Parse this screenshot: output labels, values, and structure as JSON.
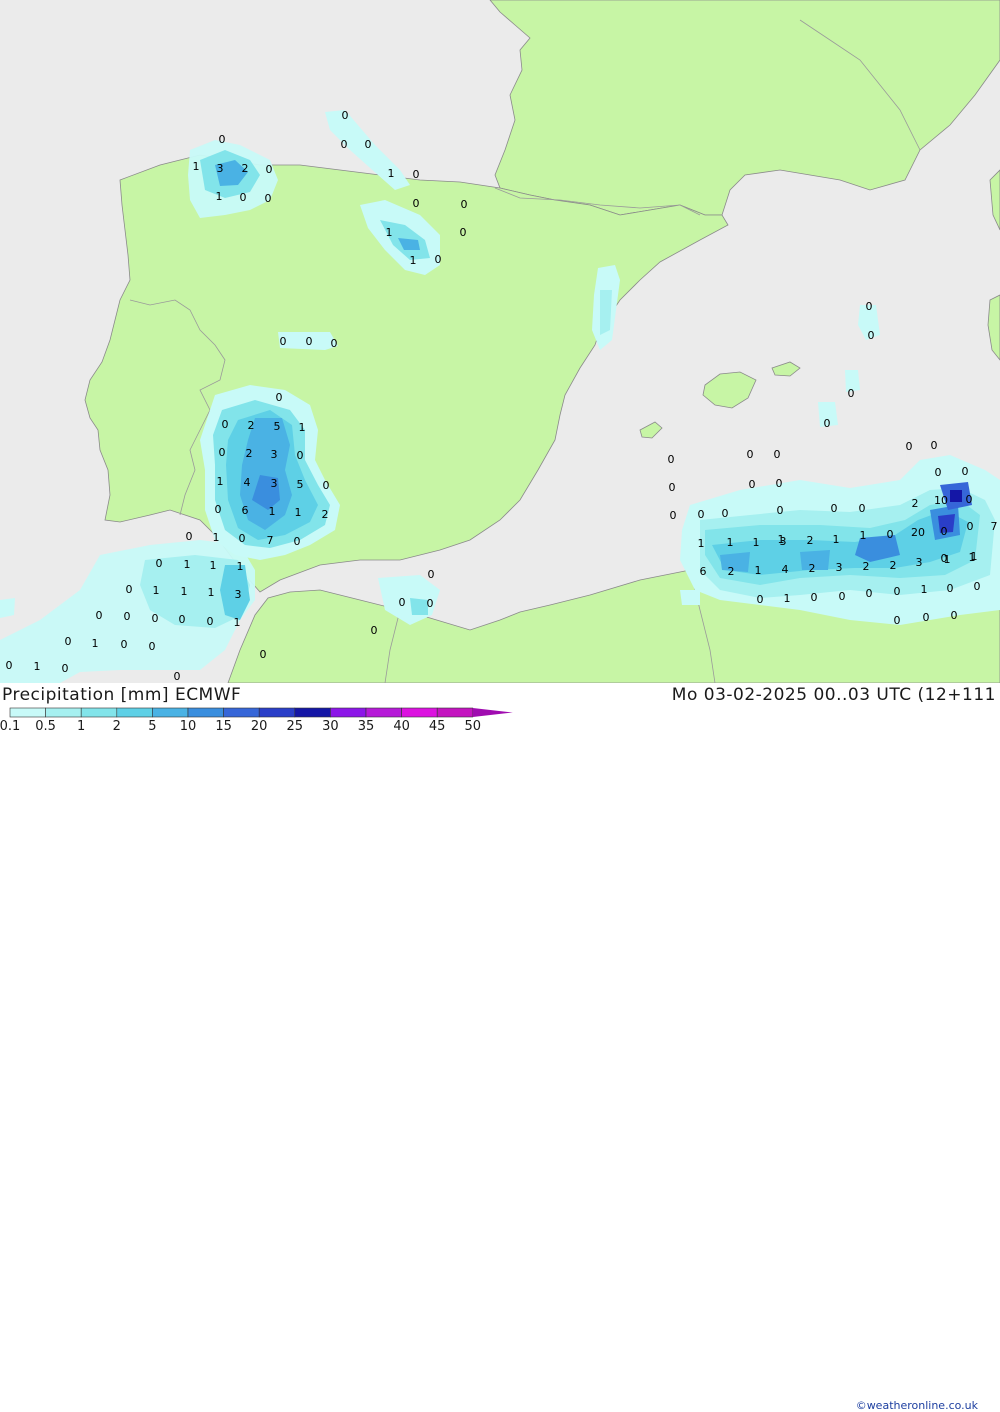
{
  "header": {
    "title": "Precipitation [mm] ECMWF",
    "datetime": "Mo 03-02-2025 00..03 UTC (12+111",
    "credit": "©weatheronline.co.uk"
  },
  "legend": {
    "labels": [
      "0.1",
      "0.5",
      "1",
      "2",
      "5",
      "10",
      "15",
      "20",
      "25",
      "30",
      "35",
      "40",
      "45",
      "50"
    ],
    "colors": [
      "#c8faf8",
      "#a6f0f0",
      "#82e4ea",
      "#5ed0e6",
      "#4ab2e4",
      "#3a8ede",
      "#3666d8",
      "#2a3ec8",
      "#1416a6",
      "#8c16e8",
      "#b61ad8",
      "#dc12e0",
      "#c414c0",
      "#a00cb0"
    ]
  },
  "colors": {
    "sea": "#ebebeb",
    "land": "#c7f5a5",
    "border": "#9a9a9a"
  },
  "map_values": [
    {
      "t": "0"
    },
    {
      "t": "1"
    },
    {
      "t": "3"
    },
    {
      "t": "2"
    },
    {
      "t": "0"
    },
    {
      "t": "1"
    },
    {
      "t": "0"
    },
    {
      "t": "0"
    },
    {
      "t": "0"
    },
    {
      "t": "0"
    },
    {
      "t": "0"
    },
    {
      "t": "1"
    },
    {
      "t": "0"
    },
    {
      "t": "0"
    },
    {
      "t": "0"
    },
    {
      "t": "0"
    },
    {
      "t": "1"
    },
    {
      "t": "1"
    },
    {
      "t": "0"
    },
    {
      "t": "0"
    },
    {
      "t": "0"
    },
    {
      "t": "0"
    },
    {
      "t": "0"
    },
    {
      "t": "0"
    },
    {
      "t": "2"
    },
    {
      "t": "5"
    },
    {
      "t": "1"
    },
    {
      "t": "0"
    },
    {
      "t": "2"
    },
    {
      "t": "3"
    },
    {
      "t": "0"
    },
    {
      "t": "1"
    },
    {
      "t": "4"
    },
    {
      "t": "3"
    },
    {
      "t": "5"
    },
    {
      "t": "0"
    },
    {
      "t": "0"
    },
    {
      "t": "6"
    },
    {
      "t": "1"
    },
    {
      "t": "1"
    },
    {
      "t": "2"
    },
    {
      "t": "0"
    },
    {
      "t": "1"
    },
    {
      "t": "0"
    },
    {
      "t": "7"
    },
    {
      "t": "0"
    },
    {
      "t": "0"
    },
    {
      "t": "1"
    },
    {
      "t": "1"
    },
    {
      "t": "1"
    },
    {
      "t": "0"
    },
    {
      "t": "1"
    },
    {
      "t": "1"
    },
    {
      "t": "1"
    },
    {
      "t": "3"
    },
    {
      "t": "0"
    },
    {
      "t": "0"
    },
    {
      "t": "0"
    },
    {
      "t": "0"
    },
    {
      "t": "0"
    },
    {
      "t": "1"
    },
    {
      "t": "0"
    },
    {
      "t": "1"
    },
    {
      "t": "0"
    },
    {
      "t": "0"
    },
    {
      "t": "0"
    },
    {
      "t": "1"
    },
    {
      "t": "0"
    },
    {
      "t": "0"
    },
    {
      "t": "0"
    },
    {
      "t": "0"
    },
    {
      "t": "0"
    },
    {
      "t": "0"
    },
    {
      "t": "0"
    },
    {
      "t": "0"
    },
    {
      "t": "0"
    },
    {
      "t": "0"
    },
    {
      "t": "0"
    },
    {
      "t": "0"
    },
    {
      "t": "0"
    },
    {
      "t": "0"
    },
    {
      "t": "0"
    },
    {
      "t": "0"
    },
    {
      "t": "0"
    },
    {
      "t": "0"
    },
    {
      "t": "0"
    },
    {
      "t": "0"
    },
    {
      "t": "0"
    },
    {
      "t": "0"
    },
    {
      "t": "0"
    },
    {
      "t": "0"
    },
    {
      "t": "2"
    },
    {
      "t": "10"
    },
    {
      "t": "0"
    },
    {
      "t": "0"
    },
    {
      "t": "0"
    },
    {
      "t": "0"
    },
    {
      "t": "0"
    },
    {
      "t": "0"
    },
    {
      "t": "7"
    },
    {
      "t": "20"
    },
    {
      "t": "0"
    },
    {
      "t": "1"
    },
    {
      "t": "1"
    },
    {
      "t": "1"
    },
    {
      "t": "1"
    },
    {
      "t": "1"
    },
    {
      "t": "3"
    },
    {
      "t": "2"
    },
    {
      "t": "1"
    },
    {
      "t": "0"
    },
    {
      "t": "1"
    },
    {
      "t": "6"
    },
    {
      "t": "2"
    },
    {
      "t": "1"
    },
    {
      "t": "4"
    },
    {
      "t": "2"
    },
    {
      "t": "3"
    },
    {
      "t": "2"
    },
    {
      "t": "2"
    },
    {
      "t": "3"
    },
    {
      "t": "1"
    },
    {
      "t": "1"
    },
    {
      "t": "0"
    },
    {
      "t": "1"
    },
    {
      "t": "0"
    },
    {
      "t": "0"
    },
    {
      "t": "0"
    },
    {
      "t": "0"
    },
    {
      "t": "1"
    },
    {
      "t": "0"
    },
    {
      "t": "0"
    },
    {
      "t": "0"
    },
    {
      "t": "0"
    },
    {
      "t": "0"
    }
  ]
}
